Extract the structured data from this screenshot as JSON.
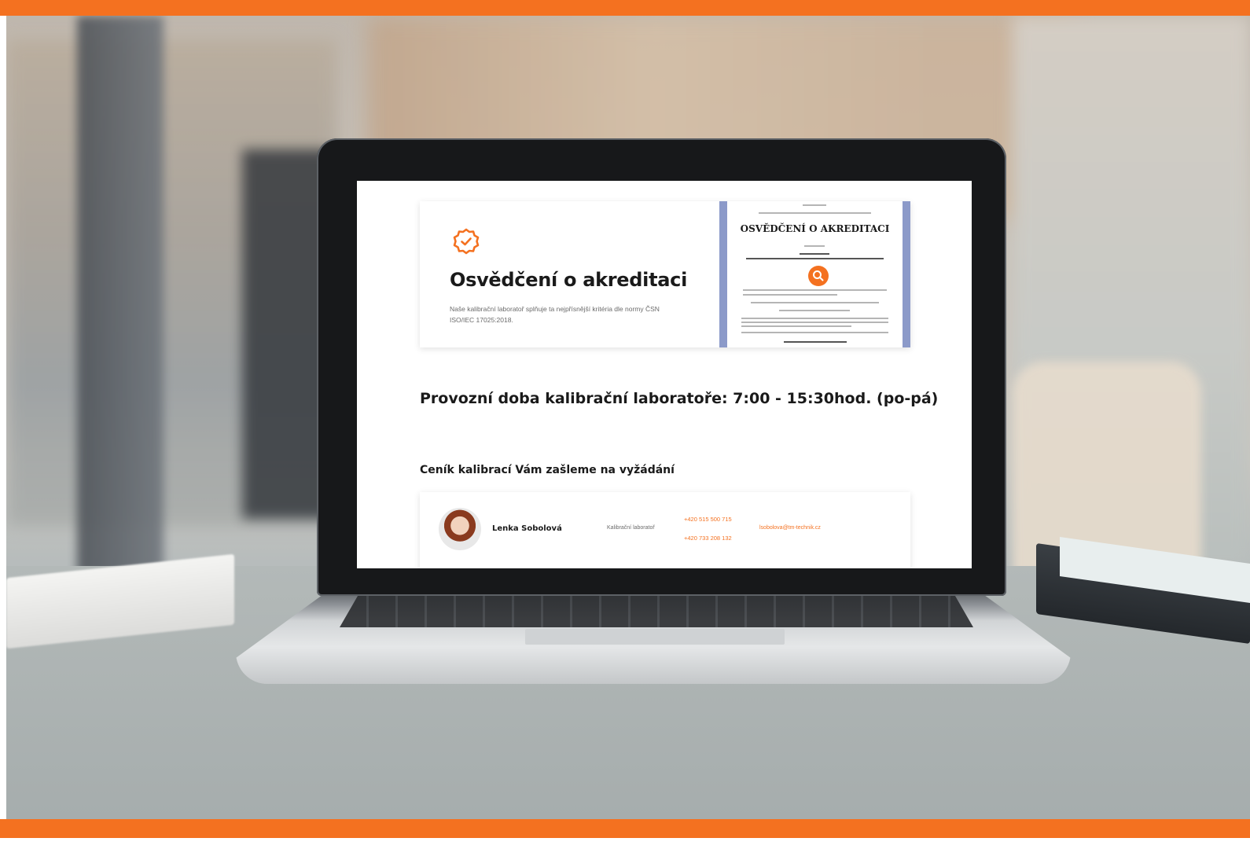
{
  "colors": {
    "accent": "#f47120",
    "cert_border": "#8c9ac9"
  },
  "screen": {
    "accreditation": {
      "icon": "badge-check-icon",
      "title": "Osvědčení o akreditaci",
      "description": "Naše kalibrační laboratoř splňuje ta nejpřísnější kritéria dle normy ČSN ISO/IEC 17025:2018.",
      "certificate_heading": "OSVĚDČENÍ O AKREDITACI",
      "zoom_icon": "search-icon"
    },
    "hours": "Provozní doba kalibrační laboratoře: 7:00 - 15:30hod. (po-pá)",
    "pricelist": "Ceník kalibrací Vám zašleme na vyžádání",
    "contact": {
      "name": "Lenka Sobolová",
      "department": "Kalibrační laboratoř",
      "phone1": "+420 515 500 715",
      "phone2": "+420 733 208 132",
      "email": "lsobolova@tm-technik.cz"
    }
  }
}
